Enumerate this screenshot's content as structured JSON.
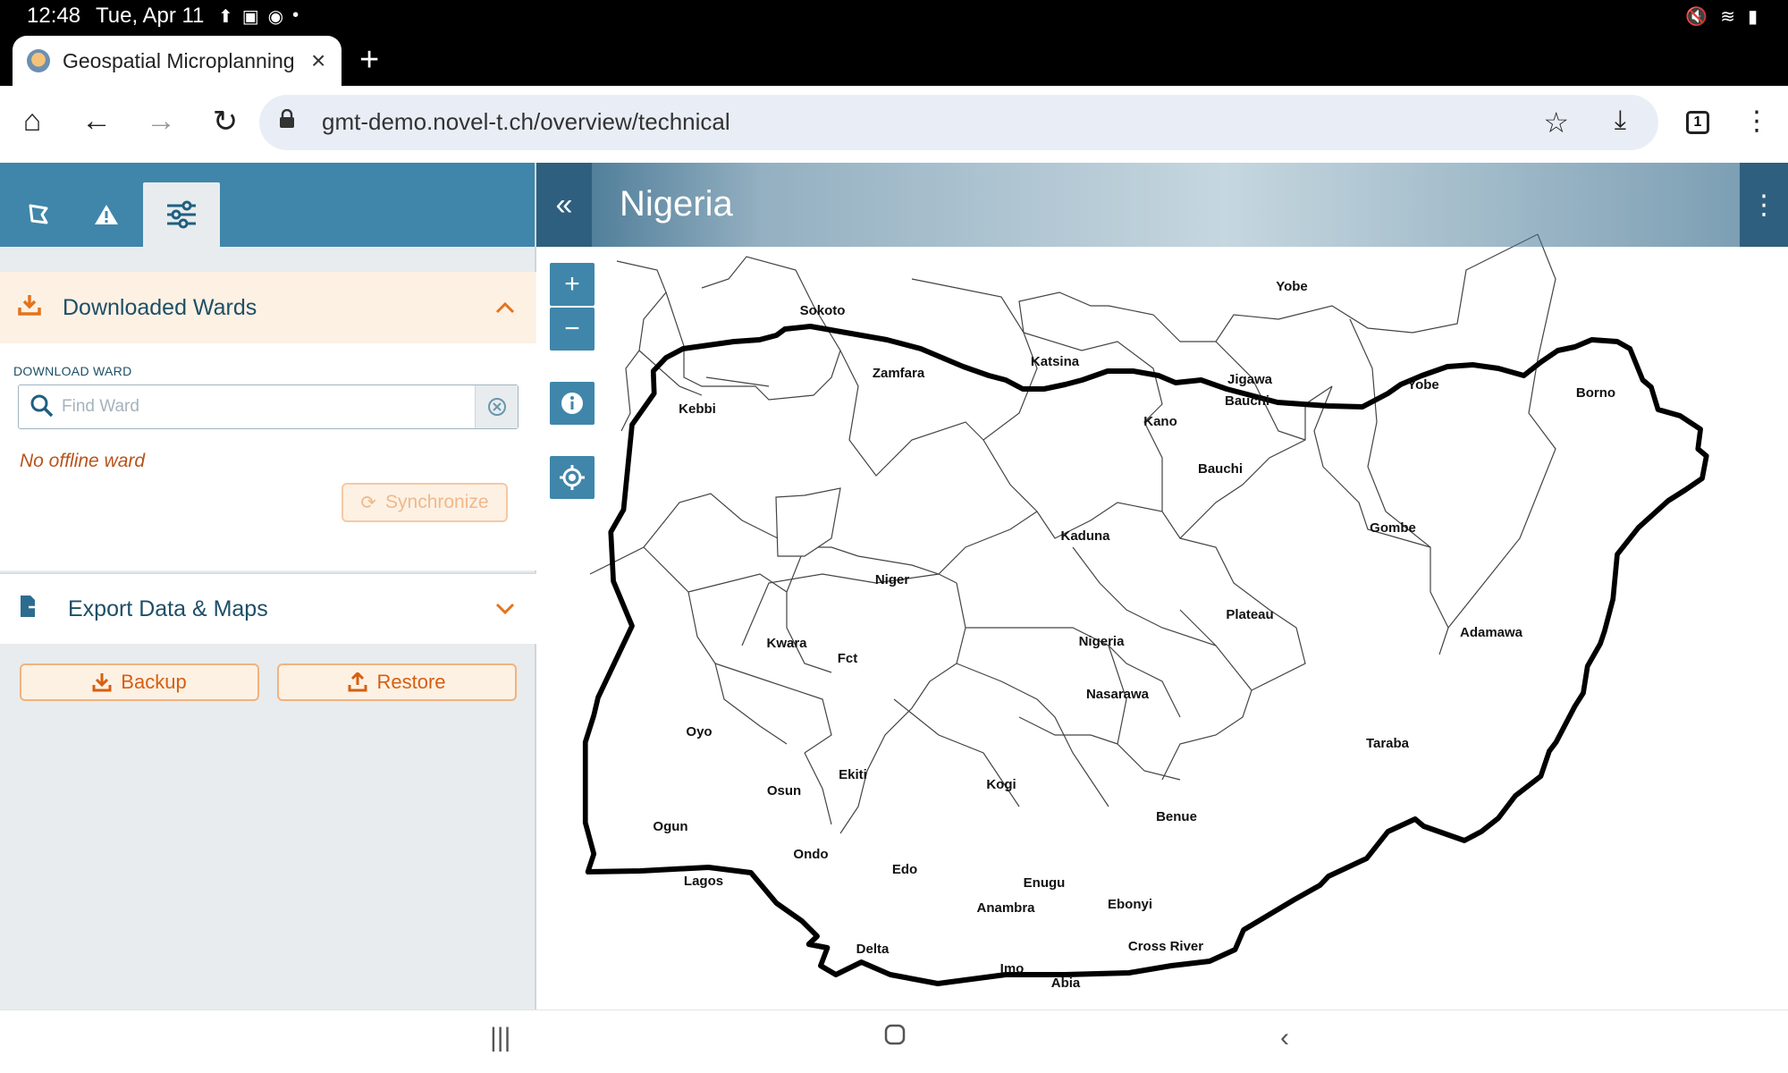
{
  "status_bar": {
    "time": "12:48",
    "date": "Tue, Apr 11"
  },
  "browser": {
    "tab_title": "Geospatial Microplanning",
    "url": "gmt-demo.novel-t.ch/overview/technical",
    "tab_count": "1"
  },
  "side_panel": {
    "downloaded_wards": {
      "title": "Downloaded Wards",
      "field_label": "DOWNLOAD WARD",
      "search_placeholder": "Find Ward",
      "empty_text": "No offline ward",
      "sync_label": "Synchronize"
    },
    "export": {
      "title": "Export Data & Maps"
    },
    "backup_label": "Backup",
    "restore_label": "Restore"
  },
  "map": {
    "title": "Nigeria",
    "zoom_in": "+",
    "zoom_out": "−",
    "labels": [
      {
        "text": "Sokoto",
        "dx": 0,
        "dy": 0
      },
      {
        "text": "Zamfara"
      },
      {
        "text": "Katsina"
      },
      {
        "text": "Yobe"
      },
      {
        "text": "Jigawa"
      },
      {
        "text": "Bauchi"
      },
      {
        "text": "Yobe"
      },
      {
        "text": "Borno"
      },
      {
        "text": "Kebbi"
      },
      {
        "text": "Kano"
      },
      {
        "text": "Bauchi"
      },
      {
        "text": "Kaduna"
      },
      {
        "text": "Gombe"
      },
      {
        "text": "Niger"
      },
      {
        "text": "Plateau"
      },
      {
        "text": "Adamawa"
      },
      {
        "text": "Kwara"
      },
      {
        "text": "Fct"
      },
      {
        "text": "Nigeria"
      },
      {
        "text": "Nasarawa"
      },
      {
        "text": "Oyo"
      },
      {
        "text": "Taraba"
      },
      {
        "text": "Ekiti"
      },
      {
        "text": "Osun"
      },
      {
        "text": "Kogi"
      },
      {
        "text": "Ogun"
      },
      {
        "text": "Benue"
      },
      {
        "text": "Ondo"
      },
      {
        "text": "Edo"
      },
      {
        "text": "Enugu"
      },
      {
        "text": "Lagos"
      },
      {
        "text": "Anambra"
      },
      {
        "text": "Ebonyi"
      },
      {
        "text": "Delta"
      },
      {
        "text": "Cross River"
      },
      {
        "text": "Imo"
      },
      {
        "text": "Abia"
      }
    ]
  }
}
